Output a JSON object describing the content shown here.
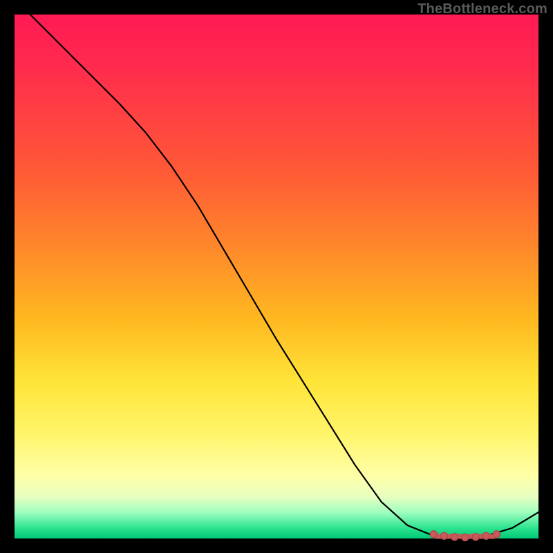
{
  "watermark": "TheBottleneck.com",
  "chart_data": {
    "type": "line",
    "title": "",
    "xlabel": "",
    "ylabel": "",
    "xlim": [
      0,
      100
    ],
    "ylim": [
      0,
      100
    ],
    "series": [
      {
        "name": "bottleneck-curve",
        "x": [
          0,
          5,
          10,
          15,
          20,
          25,
          30,
          35,
          40,
          45,
          50,
          55,
          60,
          65,
          70,
          75,
          80,
          85,
          90,
          95,
          100
        ],
        "y": [
          103,
          98,
          93,
          88,
          83,
          77.5,
          71,
          63.5,
          55,
          46.5,
          38,
          30,
          22,
          14,
          7,
          2.5,
          0.5,
          0,
          0.5,
          2,
          5
        ]
      }
    ],
    "markers": {
      "name": "marker-cluster",
      "x": [
        80,
        82,
        84,
        86,
        88,
        90,
        92
      ],
      "y": [
        0.8,
        0.5,
        0.3,
        0.2,
        0.3,
        0.5,
        0.8
      ]
    },
    "marker_bar": {
      "x0": 80.5,
      "x1": 91.5,
      "y": 0.4
    },
    "colors": {
      "curve": "#000000",
      "marker": "#c95a5a"
    }
  }
}
